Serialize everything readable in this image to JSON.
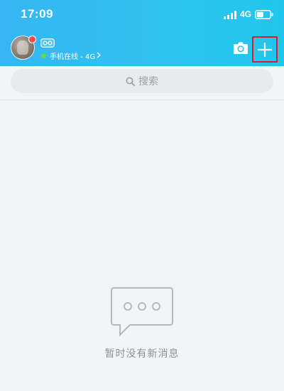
{
  "status_bar": {
    "time": "17:09",
    "network": "4G",
    "signal_icon": "signal-bars-icon",
    "battery_icon": "battery-icon"
  },
  "header": {
    "online_status": "手机在线 - 4G",
    "icons": {
      "avatar": "avatar",
      "vip": "vip-badge-icon",
      "camera": "camera-icon",
      "add": "plus-icon"
    },
    "colors": {
      "gradient_start": "#36b6f2",
      "gradient_end": "#20c7ec",
      "notify_dot": "#f24b3f",
      "online_dot": "#5fd74d",
      "highlight_box": "#d81e28"
    }
  },
  "search": {
    "placeholder": "搜索"
  },
  "empty_state": {
    "icon": "chat-bubble-icon",
    "message": "暂时没有新消息"
  }
}
